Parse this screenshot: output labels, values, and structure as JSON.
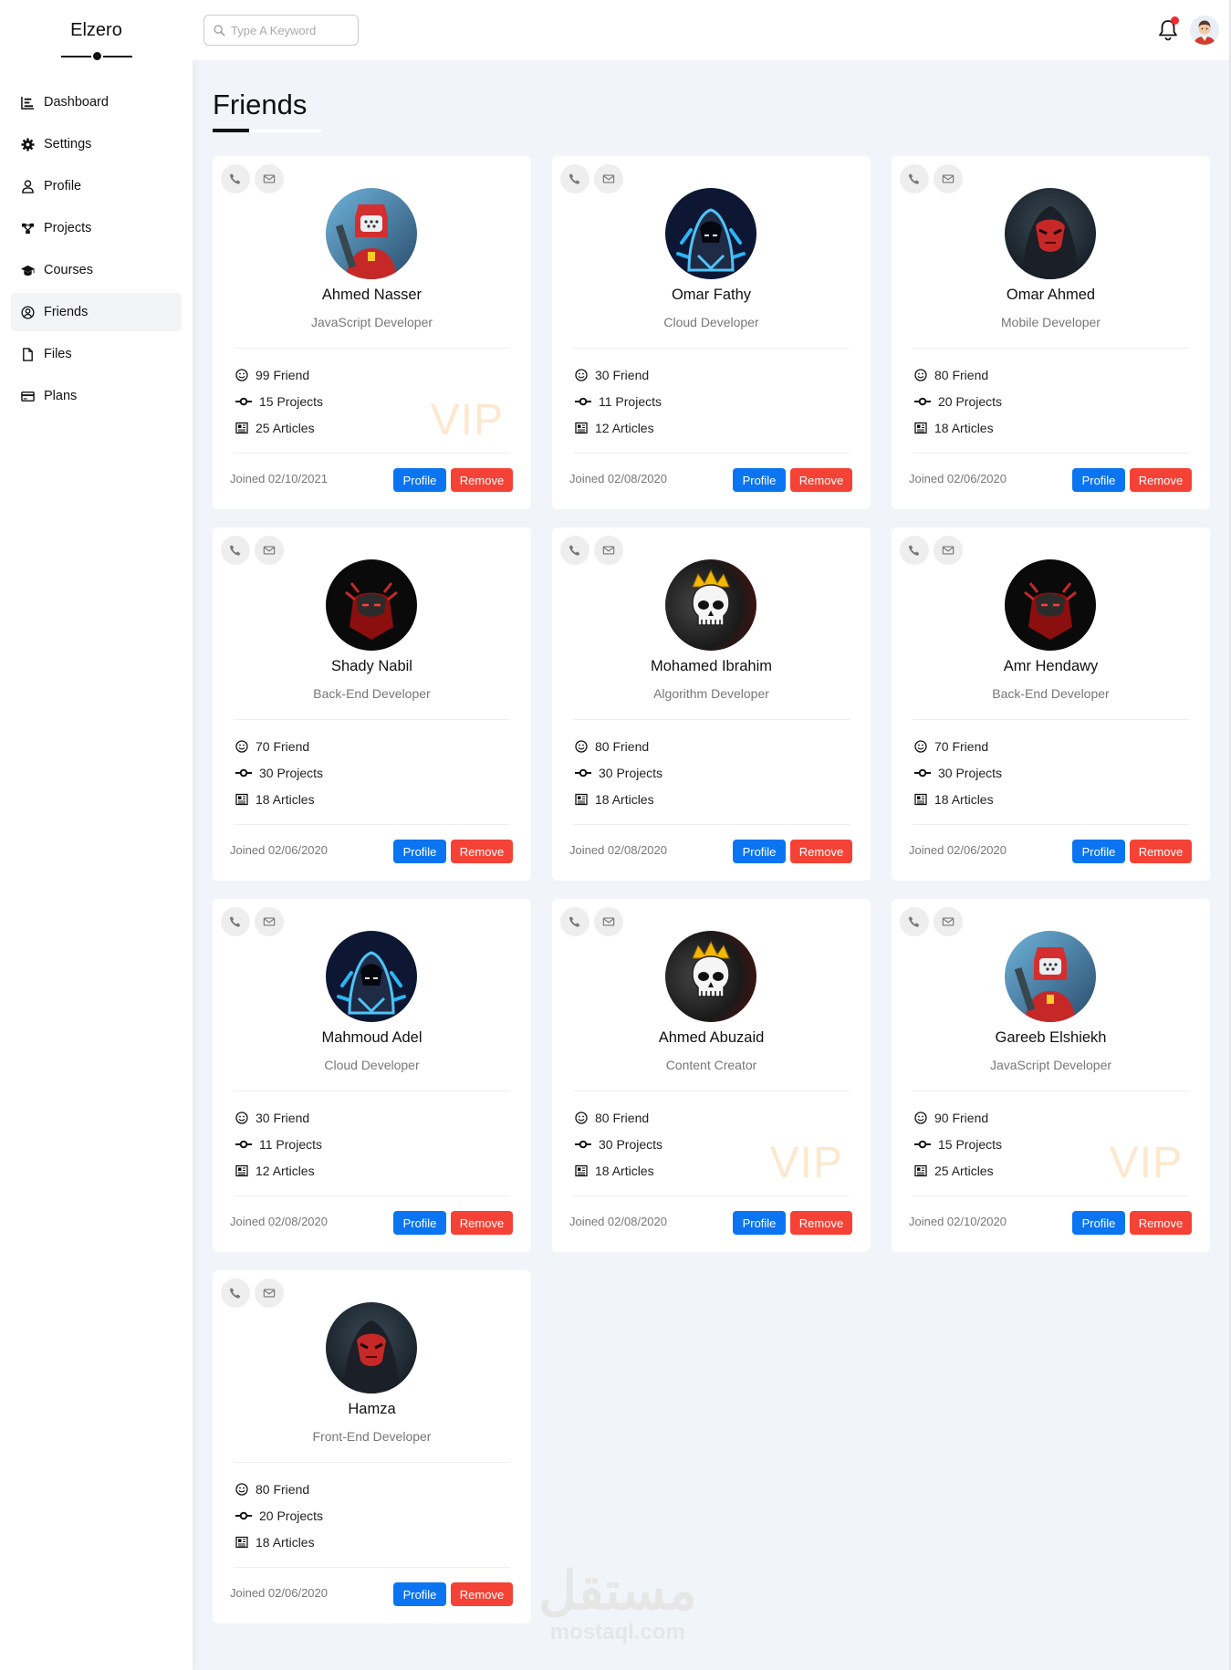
{
  "brand": "Elzero",
  "nav": [
    {
      "label": "Dashboard",
      "icon": "chart-icon"
    },
    {
      "label": "Settings",
      "icon": "gear-icon"
    },
    {
      "label": "Profile",
      "icon": "user-icon"
    },
    {
      "label": "Projects",
      "icon": "diagram-icon"
    },
    {
      "label": "Courses",
      "icon": "graduation-cap-icon"
    },
    {
      "label": "Friends",
      "icon": "user-circle-icon",
      "active": true
    },
    {
      "label": "Files",
      "icon": "file-icon"
    },
    {
      "label": "Plans",
      "icon": "credit-card-icon"
    }
  ],
  "header": {
    "search_placeholder": "Type A Keyword",
    "notification_dot_color": "#ef2c2c"
  },
  "page": {
    "title": "Friends"
  },
  "buttons": {
    "profile": "Profile",
    "remove": "Remove",
    "profile_color": "#0b75f1",
    "remove_color": "#f44336"
  },
  "friends": [
    {
      "name": "Ahmed Nasser",
      "role": "JavaScript Developer",
      "friends": "99 Friend",
      "projects": "15 Projects",
      "articles": "25 Articles",
      "joined": "Joined 02/10/2021",
      "vip": "VIP",
      "avatar": "red-robot"
    },
    {
      "name": "Omar Fathy",
      "role": "Cloud Developer",
      "friends": "30 Friend",
      "projects": "11 Projects",
      "articles": "12 Articles",
      "joined": "Joined 02/08/2020",
      "vip": "",
      "avatar": "blue-hood"
    },
    {
      "name": "Omar Ahmed",
      "role": "Mobile Developer",
      "friends": "80 Friend",
      "projects": "20 Projects",
      "articles": "18 Articles",
      "joined": "Joined 02/06/2020",
      "vip": "",
      "avatar": "red-mask"
    },
    {
      "name": "Shady Nabil",
      "role": "Back-End Developer",
      "friends": "70 Friend",
      "projects": "30 Projects",
      "articles": "18 Articles",
      "joined": "Joined 02/06/2020",
      "vip": "",
      "avatar": "red-ninja"
    },
    {
      "name": "Mohamed Ibrahim",
      "role": "Algorithm Developer",
      "friends": "80 Friend",
      "projects": "30 Projects",
      "articles": "18 Articles",
      "joined": "Joined 02/08/2020",
      "vip": "",
      "avatar": "skull-crown"
    },
    {
      "name": "Amr Hendawy",
      "role": "Back-End Developer",
      "friends": "70 Friend",
      "projects": "30 Projects",
      "articles": "18 Articles",
      "joined": "Joined 02/06/2020",
      "vip": "",
      "avatar": "red-ninja"
    },
    {
      "name": "Mahmoud Adel",
      "role": "Cloud Developer",
      "friends": "30 Friend",
      "projects": "11 Projects",
      "articles": "12 Articles",
      "joined": "Joined 02/08/2020",
      "vip": "",
      "avatar": "blue-hood"
    },
    {
      "name": "Ahmed Abuzaid",
      "role": "Content Creator",
      "friends": "80 Friend",
      "projects": "30 Projects",
      "articles": "18 Articles",
      "joined": "Joined 02/08/2020",
      "vip": "VIP",
      "avatar": "skull-crown"
    },
    {
      "name": "Gareeb Elshiekh",
      "role": "JavaScript Developer",
      "friends": "90 Friend",
      "projects": "15 Projects",
      "articles": "25 Articles",
      "joined": "Joined 02/10/2020",
      "vip": "VIP",
      "avatar": "red-robot"
    },
    {
      "name": "Hamza",
      "role": "Front-End Developer",
      "friends": "80 Friend",
      "projects": "20 Projects",
      "articles": "18 Articles",
      "joined": "Joined 02/06/2020",
      "vip": "",
      "avatar": "red-mask"
    }
  ],
  "watermark": {
    "arabic": "مستقل",
    "latin": "mostaql.com"
  }
}
